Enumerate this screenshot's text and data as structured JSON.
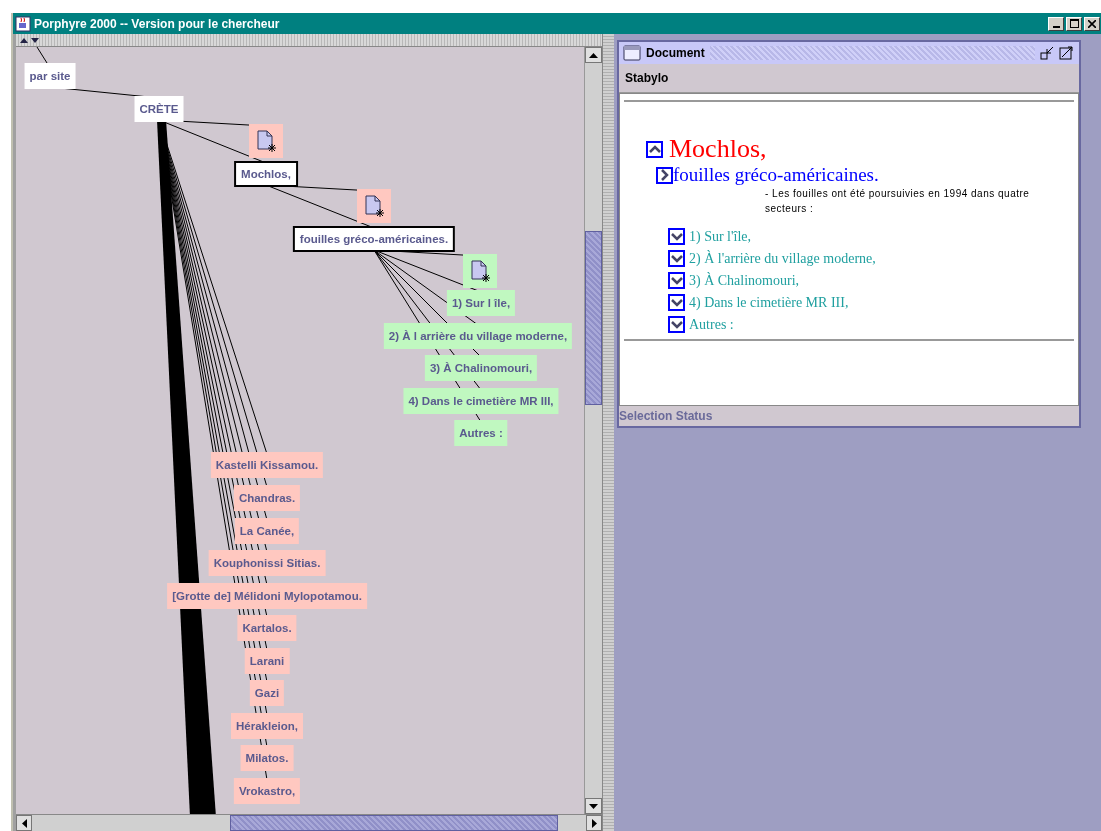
{
  "window": {
    "title": "Porphyre 2000 -- Version pour le chercheur"
  },
  "graph": {
    "nodes": [
      {
        "kind": "label",
        "label": "par site",
        "color": "#ffffff",
        "selected": false
      },
      {
        "kind": "label",
        "label": "CRÈTE",
        "color": "#ffffff",
        "selected": false
      },
      {
        "kind": "document",
        "color": "#ffc8c0",
        "selected": false
      },
      {
        "kind": "label",
        "label": "Mochlos,",
        "color": "#ffffff",
        "selected": true
      },
      {
        "kind": "document",
        "color": "#ffc8c0",
        "selected": false
      },
      {
        "kind": "label",
        "label": "fouilles gréco-américaines.",
        "color": "#ffffff",
        "selected": true
      },
      {
        "kind": "document",
        "color": "#c0f8c0",
        "selected": false
      },
      {
        "kind": "label",
        "label": "1) Sur l île,",
        "color": "#c0f8c0",
        "selected": false
      },
      {
        "kind": "label",
        "label": "2) À l arrière du village moderne,",
        "color": "#c0f8c0",
        "selected": false
      },
      {
        "kind": "label",
        "label": "3) À Chalinomouri,",
        "color": "#c0f8c0",
        "selected": false
      },
      {
        "kind": "label",
        "label": "4) Dans le cimetière MR III,",
        "color": "#c0f8c0",
        "selected": false
      },
      {
        "kind": "label",
        "label": "Autres :",
        "color": "#c0f8c0",
        "selected": false
      },
      {
        "kind": "label",
        "label": "Kastelli Kissamou.",
        "color": "#ffc8c0",
        "selected": false
      },
      {
        "kind": "label",
        "label": "Chandras.",
        "color": "#ffc8c0",
        "selected": false
      },
      {
        "kind": "label",
        "label": "La Canée,",
        "color": "#ffc8c0",
        "selected": false
      },
      {
        "kind": "label",
        "label": "Kouphonissi Sitias.",
        "color": "#ffc8c0",
        "selected": false
      },
      {
        "kind": "label",
        "label": "[Grotte de] Mélidoni Mylopotamou.",
        "color": "#ffc8c0",
        "selected": false
      },
      {
        "kind": "label",
        "label": "Kartalos.",
        "color": "#ffc8c0",
        "selected": false
      },
      {
        "kind": "label",
        "label": "Larani",
        "color": "#ffc8c0",
        "selected": false
      },
      {
        "kind": "label",
        "label": "Gazi",
        "color": "#ffc8c0",
        "selected": false
      },
      {
        "kind": "label",
        "label": "Hérakleion,",
        "color": "#ffc8c0",
        "selected": false
      },
      {
        "kind": "label",
        "label": "Milatos.",
        "color": "#ffc8c0",
        "selected": false
      },
      {
        "kind": "label",
        "label": "Vrokastro,",
        "color": "#ffc8c0",
        "selected": false
      }
    ]
  },
  "document": {
    "title": "Document",
    "menu": [
      "Stabylo"
    ],
    "heading": {
      "text": "Mochlos,",
      "expanded": true
    },
    "subheading": {
      "text": "fouilles gréco-américaines."
    },
    "note": "- Les fouilles ont été poursuivies en 1994 dans quatre secteurs :",
    "sections": [
      {
        "text": "1) Sur l'île,",
        "expanded": false
      },
      {
        "text": "2) À l'arrière du village moderne,",
        "expanded": false
      },
      {
        "text": "3) À Chalinomouri,",
        "expanded": false
      },
      {
        "text": "4) Dans le cimetière MR III,",
        "expanded": false
      },
      {
        "text": "Autres :",
        "expanded": false
      }
    ],
    "status": "Selection Status"
  }
}
